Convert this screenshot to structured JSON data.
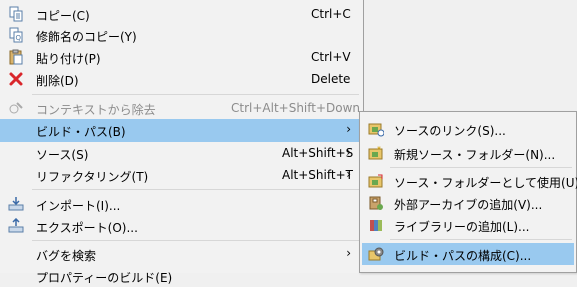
{
  "main_menu": {
    "items": [
      {
        "label": "コピー(C)",
        "shortcut": "Ctrl+C",
        "icon": "copy-icon"
      },
      {
        "label": "修飾名のコピー(Y)",
        "shortcut": "",
        "icon": "copy-qualified-name-icon"
      },
      {
        "label": "貼り付け(P)",
        "shortcut": "Ctrl+V",
        "icon": "paste-icon"
      },
      {
        "label": "削除(D)",
        "shortcut": "Delete",
        "icon": "delete-icon"
      },
      {
        "label": "コンテキストから除去",
        "shortcut": "Ctrl+Alt+Shift+Down",
        "icon": "remove-from-context-icon"
      },
      {
        "label": "ビルド・パス(B)",
        "shortcut": "",
        "arrow": "›"
      },
      {
        "label": "ソース(S)",
        "shortcut": "Alt+Shift+S",
        "arrow": "›"
      },
      {
        "label": "リファクタリング(T)",
        "shortcut": "Alt+Shift+T",
        "arrow": "›"
      },
      {
        "label": "インポート(I)...",
        "shortcut": "",
        "icon": "import-icon"
      },
      {
        "label": "エクスポート(O)...",
        "shortcut": "",
        "icon": "export-icon"
      },
      {
        "label": "バグを検索",
        "shortcut": "",
        "arrow": "›"
      },
      {
        "label": "プロパティーのビルド(E)",
        "shortcut": ""
      }
    ]
  },
  "sub_menu": {
    "items": [
      {
        "label": "ソースのリンク(S)...",
        "icon": "link-source-icon"
      },
      {
        "label": "新規ソース・フォルダー(N)...",
        "icon": "new-source-folder-icon"
      },
      {
        "label": "ソース・フォルダーとして使用(U)",
        "icon": "use-as-source-folder-icon"
      },
      {
        "label": "外部アーカイブの追加(V)...",
        "icon": "add-external-archive-icon"
      },
      {
        "label": "ライブラリーの追加(L)...",
        "icon": "add-library-icon"
      },
      {
        "label": "ビルド・パスの構成(C)...",
        "icon": "configure-build-path-icon"
      }
    ]
  }
}
